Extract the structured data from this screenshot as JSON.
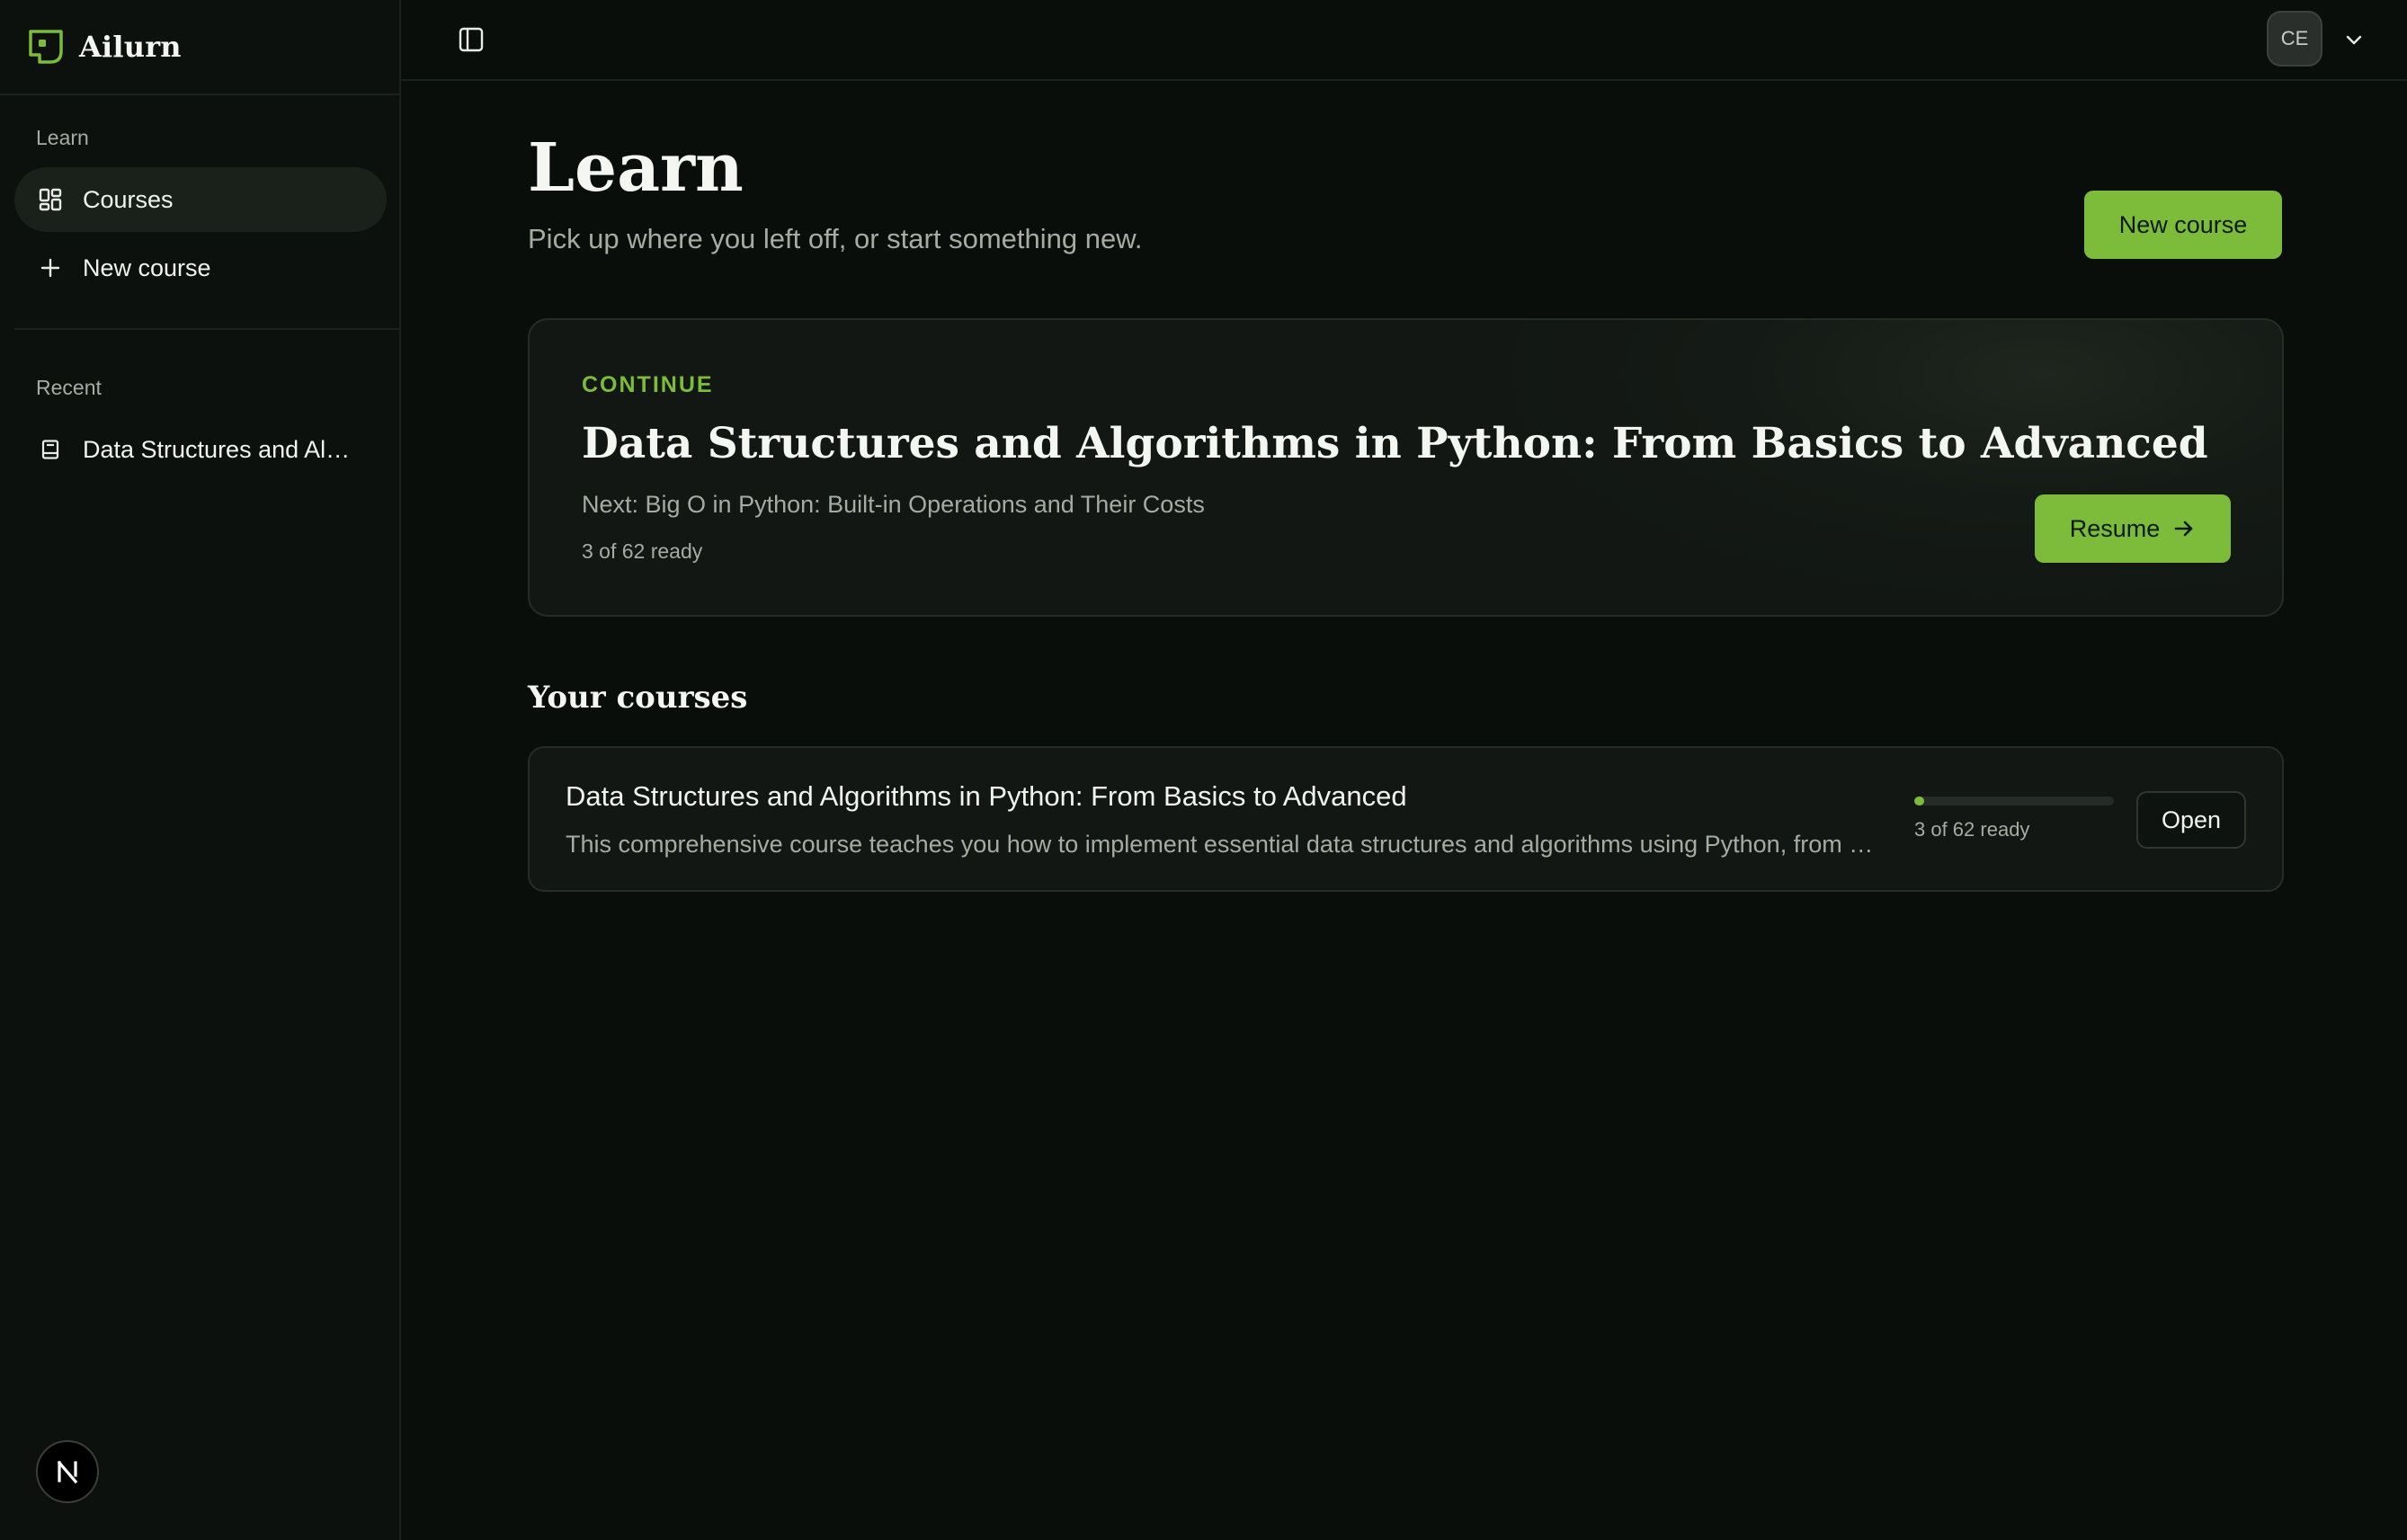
{
  "brand": {
    "name": "Ailurn",
    "logo_icon": "ailurn-logo-icon"
  },
  "sidebar": {
    "learn_label": "Learn",
    "items": [
      {
        "label": "Courses",
        "icon": "grid-icon",
        "active": true
      },
      {
        "label": "New course",
        "icon": "plus-icon",
        "active": false
      }
    ],
    "recent_label": "Recent",
    "recent": [
      {
        "label": "Data Structures and Algorithms in Python: From Basics to Advanced",
        "icon": "book-icon"
      }
    ]
  },
  "topbar": {
    "avatar_initials": "CE"
  },
  "page": {
    "title": "Learn",
    "subtitle": "Pick up where you left off, or start something new.",
    "new_course_label": "New course"
  },
  "continue_card": {
    "label": "CONTINUE",
    "title": "Data Structures and Algorithms in Python: From Basics to Advanced",
    "next": "Next: Big O in Python: Built-in Operations and Their Costs",
    "ready": "3 of 62 ready",
    "resume_label": "Resume"
  },
  "courses": {
    "section_title": "Your courses",
    "items": [
      {
        "title": "Data Structures and Algorithms in Python: From Basics to Advanced",
        "description": "This comprehensive course teaches you how to implement essential data structures and algorithms using Python, from basic concepts to advanced techniques.",
        "progress_label": "3 of 62 ready",
        "progress_ready": 3,
        "progress_total": 62,
        "open_label": "Open"
      }
    ]
  },
  "colors": {
    "accent": "#7cbc3a",
    "background": "#0a0e0b",
    "sidebar": "#0c110d"
  }
}
